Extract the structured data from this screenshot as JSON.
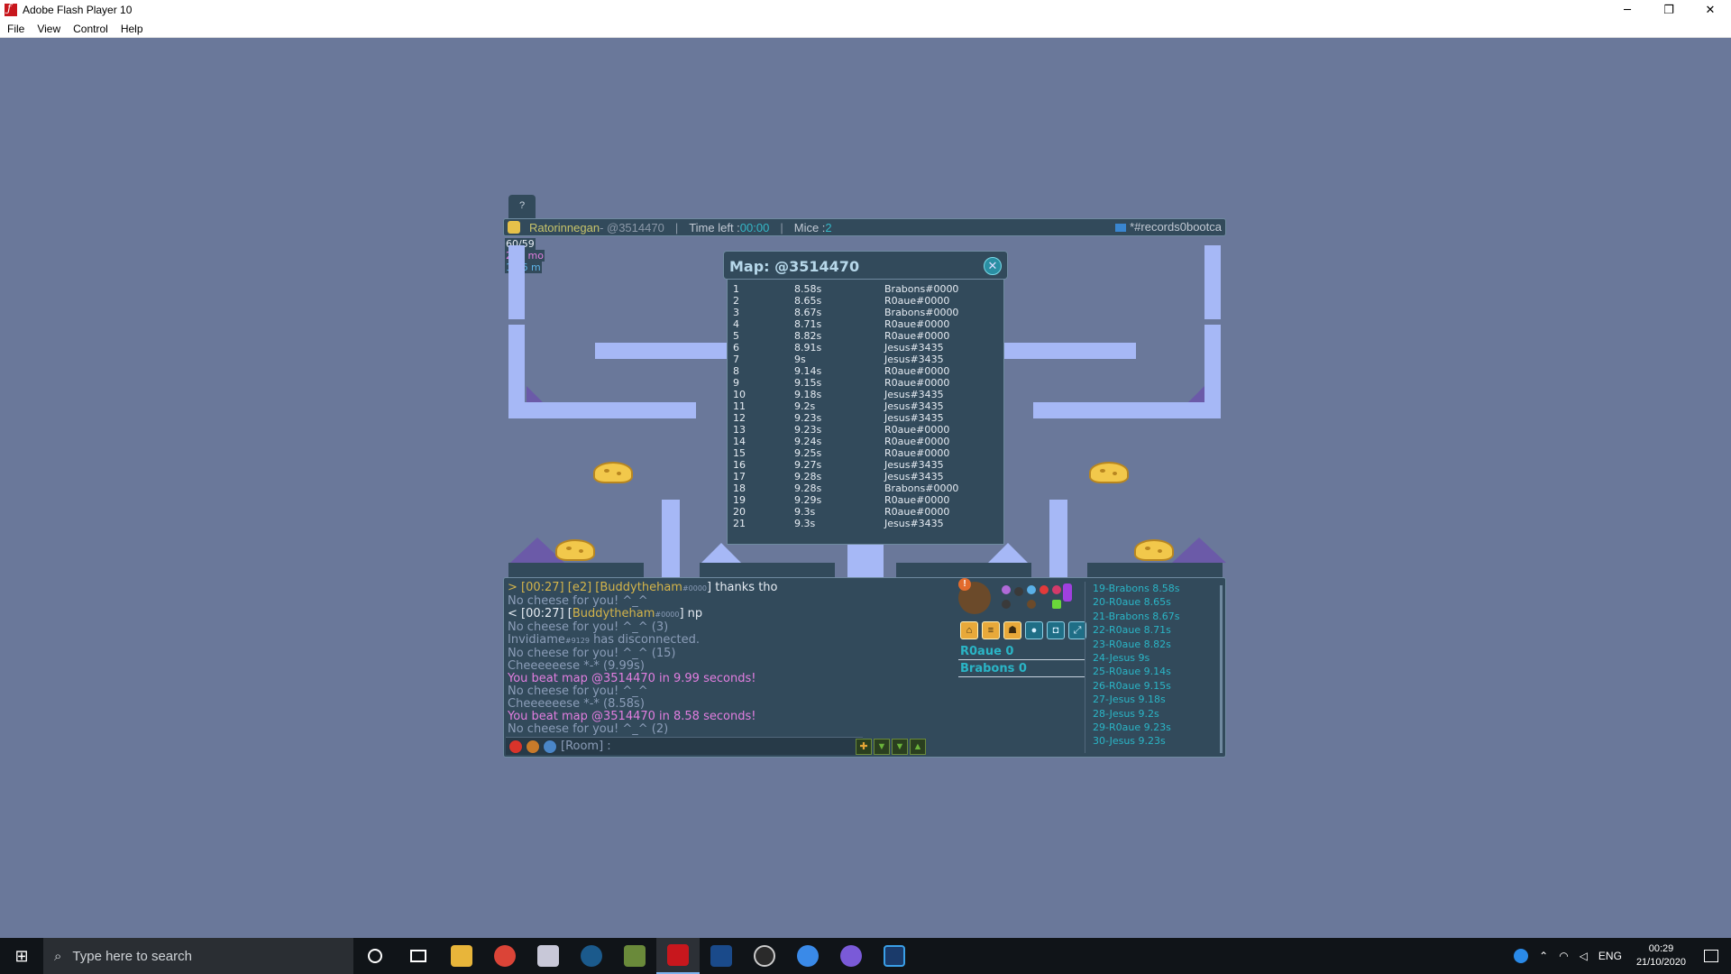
{
  "window": {
    "title": "Adobe Flash Player 10",
    "controls": {
      "minimize": "─",
      "restore": "❐",
      "close": "✕"
    }
  },
  "menu": [
    "File",
    "View",
    "Control",
    "Help"
  ],
  "game": {
    "help_tab": "?",
    "topbar": {
      "creator": "Ratorinnegan",
      "code": " - @3514470",
      "time_label": "Time left : ",
      "time_value": "00:00",
      "mice_label": "Mice : ",
      "mice_value": "2",
      "room": "*#records0bootca"
    },
    "stats": [
      "60/59",
      "222 mo",
      "1.16 m"
    ],
    "popup": {
      "title": "Map: @3514470",
      "close": "✕",
      "records": [
        {
          "rank": "1",
          "time": "8.58s",
          "player": "Brabons#0000"
        },
        {
          "rank": "2",
          "time": "8.65s",
          "player": "R0aue#0000"
        },
        {
          "rank": "3",
          "time": "8.67s",
          "player": "Brabons#0000"
        },
        {
          "rank": "4",
          "time": "8.71s",
          "player": "R0aue#0000"
        },
        {
          "rank": "5",
          "time": "8.82s",
          "player": "R0aue#0000"
        },
        {
          "rank": "6",
          "time": "8.91s",
          "player": "Jesus#3435"
        },
        {
          "rank": "7",
          "time": "9s",
          "player": "Jesus#3435"
        },
        {
          "rank": "8",
          "time": "9.14s",
          "player": "R0aue#0000"
        },
        {
          "rank": "9",
          "time": "9.15s",
          "player": "R0aue#0000"
        },
        {
          "rank": "10",
          "time": "9.18s",
          "player": "Jesus#3435"
        },
        {
          "rank": "11",
          "time": "9.2s",
          "player": "Jesus#3435"
        },
        {
          "rank": "12",
          "time": "9.23s",
          "player": "Jesus#3435"
        },
        {
          "rank": "13",
          "time": "9.23s",
          "player": "R0aue#0000"
        },
        {
          "rank": "14",
          "time": "9.24s",
          "player": "R0aue#0000"
        },
        {
          "rank": "15",
          "time": "9.25s",
          "player": "R0aue#0000"
        },
        {
          "rank": "16",
          "time": "9.27s",
          "player": "Jesus#3435"
        },
        {
          "rank": "17",
          "time": "9.28s",
          "player": "Jesus#3435"
        },
        {
          "rank": "18",
          "time": "9.28s",
          "player": "Brabons#0000"
        },
        {
          "rank": "19",
          "time": "9.29s",
          "player": "R0aue#0000"
        },
        {
          "rank": "20",
          "time": "9.3s",
          "player": "R0aue#0000"
        },
        {
          "rank": "21",
          "time": "9.3s",
          "player": "Jesus#3435"
        }
      ]
    },
    "chat": [
      {
        "parts": [
          {
            "t": "> [00:27] [e2] [",
            "c": "c-gold"
          },
          {
            "t": "Buddytheham",
            "c": "c-gold"
          },
          {
            "t": "#0000",
            "c": "tag"
          },
          {
            "t": "] thanks tho",
            "c": "c-white"
          }
        ]
      },
      {
        "parts": [
          {
            "t": "No cheese for you! ^_^",
            "c": "c-gray"
          }
        ]
      },
      {
        "parts": [
          {
            "t": "< [00:27] [",
            "c": "c-white"
          },
          {
            "t": "Buddytheham",
            "c": "c-gold"
          },
          {
            "t": "#0000",
            "c": "tag"
          },
          {
            "t": "] np",
            "c": "c-white"
          }
        ]
      },
      {
        "parts": [
          {
            "t": "No cheese for you! ^_^ (3)",
            "c": "c-gray"
          }
        ]
      },
      {
        "parts": [
          {
            "t": "Invidiame",
            "c": "c-gray"
          },
          {
            "t": "#9129",
            "c": "tag"
          },
          {
            "t": " has disconnected.",
            "c": "c-gray"
          }
        ]
      },
      {
        "parts": [
          {
            "t": "No cheese for you! ^_^ (15)",
            "c": "c-gray"
          }
        ]
      },
      {
        "parts": [
          {
            "t": "Cheeeeeese *-* ",
            "c": "c-gray"
          },
          {
            "t": "(9.99s)",
            "c": "c-gray"
          }
        ]
      },
      {
        "parts": [
          {
            "t": "You beat map @3514470 in 9.99 seconds!",
            "c": "c-pink"
          }
        ]
      },
      {
        "parts": [
          {
            "t": "No cheese for you! ^_^",
            "c": "c-gray"
          }
        ]
      },
      {
        "parts": [
          {
            "t": "Cheeeeeese *-* (8.58s)",
            "c": "c-gray"
          }
        ]
      },
      {
        "parts": [
          {
            "t": "You beat map @3514470 in 8.58 seconds!",
            "c": "c-pink"
          }
        ]
      },
      {
        "parts": [
          {
            "t": "No cheese for you! ^_^ (2)",
            "c": "c-gray"
          }
        ]
      }
    ],
    "chat_input_placeholder": "[Room] :",
    "teams": [
      "R0aue 0",
      "Brabons 0"
    ],
    "scoreboard": [
      "19-Brabons 8.58s",
      "20-R0aue 8.65s",
      "21-Brabons 8.67s",
      "22-R0aue 8.71s",
      "23-R0aue 8.82s",
      "24-Jesus 9s",
      "25-R0aue 9.14s",
      "26-R0aue 9.15s",
      "27-Jesus 9.18s",
      "28-Jesus 9.2s",
      "29-R0aue 9.23s",
      "30-Jesus 9.23s"
    ]
  },
  "taskbar": {
    "search_placeholder": "Type here to search",
    "language": "ENG",
    "time": "00:29",
    "date": "21/10/2020"
  }
}
